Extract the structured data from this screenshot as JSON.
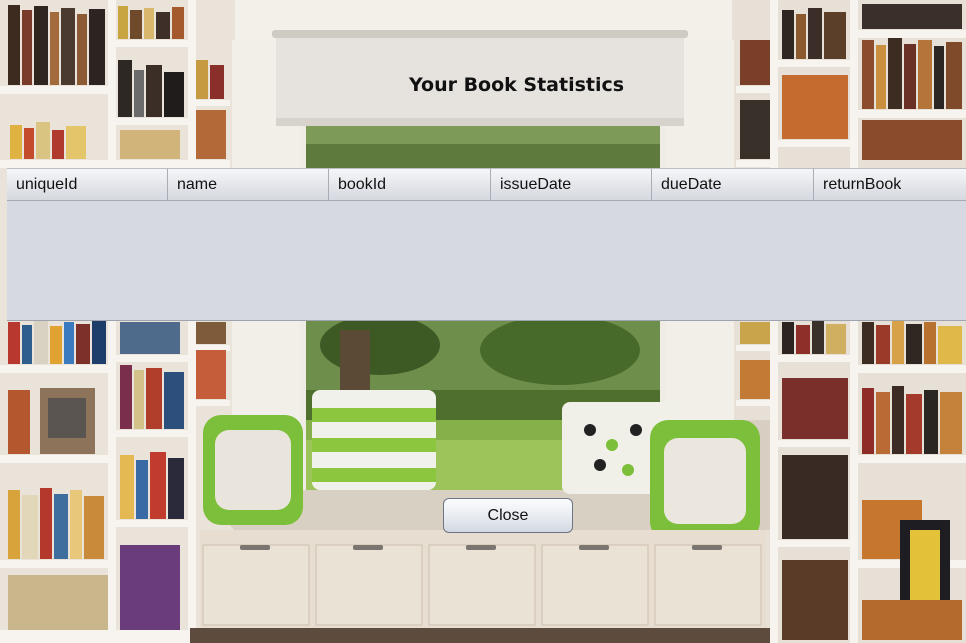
{
  "window": {
    "title": "Your Book Statistics"
  },
  "table": {
    "columns": [
      "uniqueId",
      "name",
      "bookId",
      "issueDate",
      "dueDate",
      "returnBook"
    ],
    "rows": []
  },
  "buttons": {
    "close_label": "Close"
  }
}
